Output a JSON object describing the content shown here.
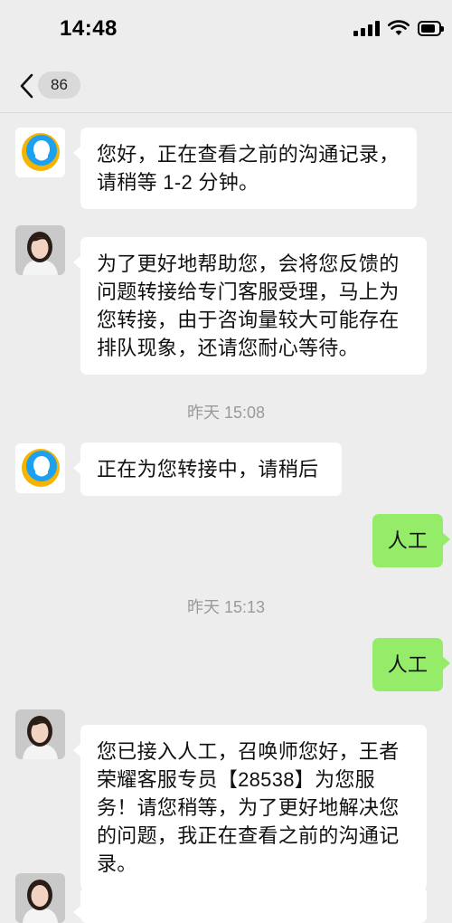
{
  "status_bar": {
    "time": "14:48"
  },
  "nav": {
    "unread_count": "86"
  },
  "messages": [
    {
      "type": "incoming",
      "avatar": "qq-bot-icon",
      "text": "您好，正在查看之前的沟通记录，请稍等 1-2 分钟。"
    },
    {
      "type": "incoming",
      "avatar": "agent-avatar",
      "text": "为了更好地帮助您，会将您反馈的问题转接给专门客服受理，马上为您转接，由于咨询量较大可能存在排队现象，还请您耐心等待。"
    },
    {
      "type": "timestamp",
      "text": "昨天 15:08"
    },
    {
      "type": "incoming",
      "avatar": "qq-bot-icon",
      "text": "正在为您转接中，请稍后"
    },
    {
      "type": "outgoing",
      "text": "人工"
    },
    {
      "type": "timestamp",
      "text": "昨天 15:13"
    },
    {
      "type": "outgoing",
      "text": "人工"
    },
    {
      "type": "incoming",
      "avatar": "agent-avatar",
      "text": "您已接入人工，召唤师您好，王者荣耀客服专员【28538】为您服务！请您稍等，为了更好地解决您的问题，我正在查看之前的沟通记录。"
    }
  ],
  "colors": {
    "background": "#ededed",
    "outgoing_bubble": "#95ec69",
    "incoming_bubble": "#ffffff"
  }
}
